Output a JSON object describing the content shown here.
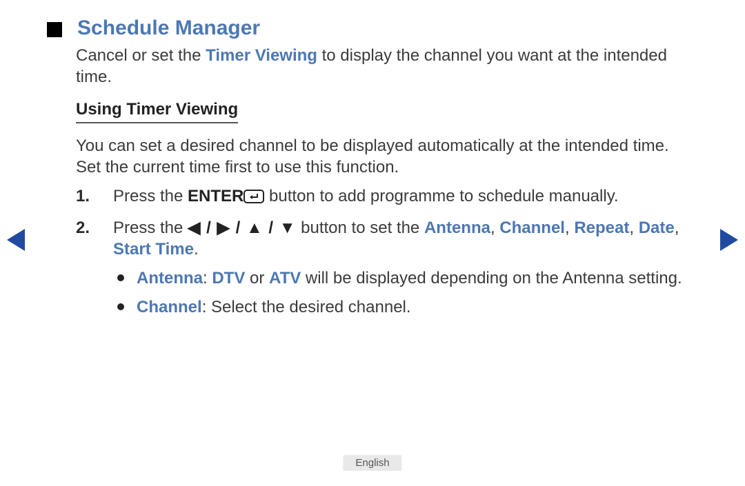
{
  "title": "Schedule Manager",
  "intro_pre": "Cancel or set the ",
  "intro_link": "Timer Viewing",
  "intro_post": " to display the channel you want at the intended time.",
  "subhead": "Using Timer Viewing",
  "desc": "You can set a desired channel to be displayed automatically at the intended time. Set the current time first to use this function.",
  "step1": {
    "pre": "Press the ",
    "enter_word": "ENTER",
    "post": " button to add programme to schedule manually."
  },
  "step2": {
    "pre": "Press the ",
    "arrows": "◀ / ▶ / ▲ / ▼",
    "mid": " button to set the ",
    "settings": [
      "Antenna",
      "Channel",
      "Repeat",
      "Date",
      "Start Time"
    ],
    "sep": ", ",
    "end": "."
  },
  "bullet1": {
    "label": "Antenna",
    "colon": ": ",
    "opt1": "DTV",
    "ormid": " or ",
    "opt2": "ATV",
    "tail": " will be displayed depending on the Antenna setting."
  },
  "bullet2": {
    "label": "Channel",
    "tail": ": Select the desired channel."
  },
  "footer_lang": "English"
}
